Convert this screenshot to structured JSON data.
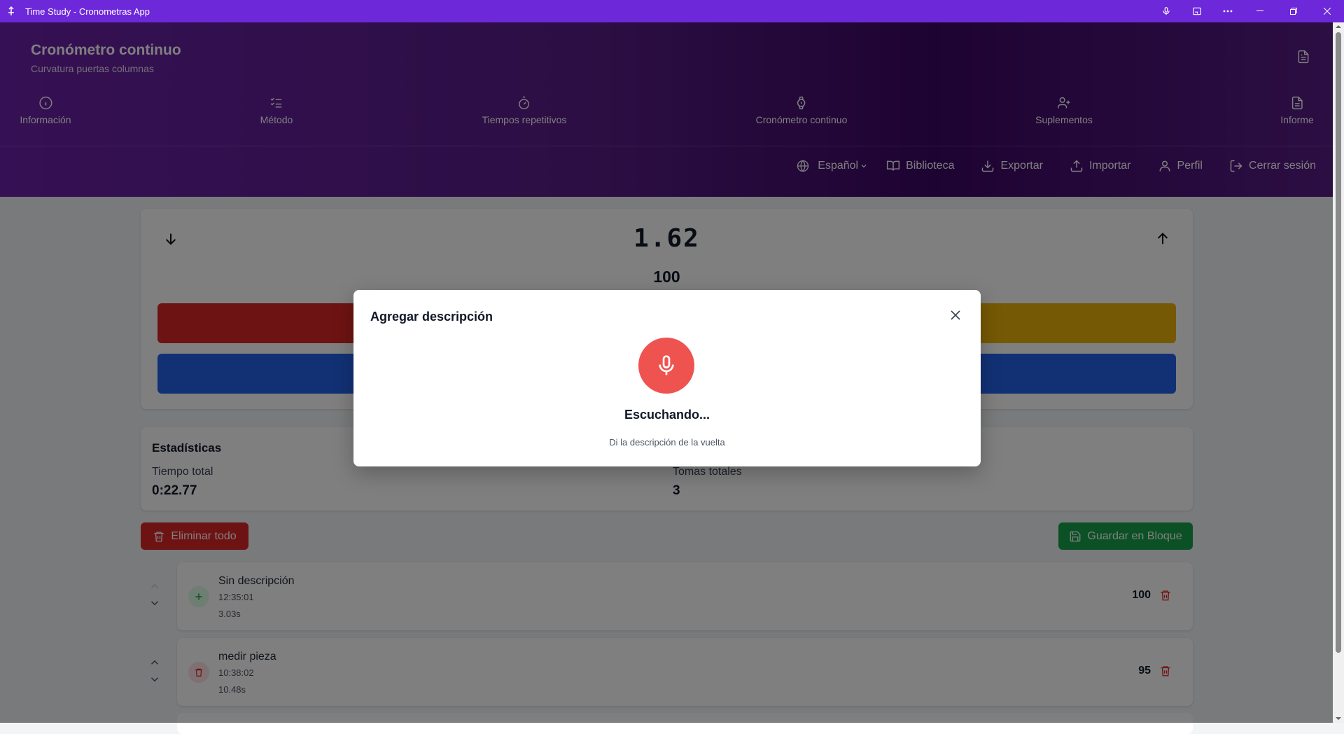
{
  "window": {
    "title": "Time Study - Cronometras App",
    "controls": [
      "microphone",
      "cast",
      "more",
      "minimize",
      "restore",
      "close"
    ]
  },
  "header": {
    "title": "Cronómetro continuo",
    "subtitle": "Curvatura puertas columnas",
    "tabs": [
      {
        "label": "Información",
        "icon": "info-icon"
      },
      {
        "label": "Método",
        "icon": "list-checks-icon"
      },
      {
        "label": "Tiempos repetitivos",
        "icon": "timer-icon"
      },
      {
        "label": "Cronómetro continuo",
        "icon": "watch-icon"
      },
      {
        "label": "Suplementos",
        "icon": "user-plus-icon"
      },
      {
        "label": "Informe",
        "icon": "file-icon"
      }
    ],
    "toolbar": {
      "language": "Español",
      "library": "Biblioteca",
      "export": "Exportar",
      "import": "Importar",
      "profile": "Perfil",
      "logout": "Cerrar sesión"
    }
  },
  "timer": {
    "value": "1.62",
    "rating": "100"
  },
  "stats": {
    "title": "Estadísticas",
    "total_time_label": "Tiempo total",
    "total_time_value": "0:22.77",
    "total_takes_label": "Tomas totales",
    "total_takes_value": "3"
  },
  "actions": {
    "delete_all": "Eliminar todo",
    "save_block": "Guardar en Bloque"
  },
  "laps": [
    {
      "description": "Sin descripción",
      "time": "12:35:01",
      "duration": "3.03s",
      "rating": "100"
    },
    {
      "description": "medir pieza",
      "time": "10:38:02",
      "duration": "10.48s",
      "rating": "95"
    }
  ],
  "modal": {
    "title": "Agregar descripción",
    "status": "Escuchando...",
    "hint": "Di la descripción de la vuelta"
  },
  "colors": {
    "titlebar": "#6d28d9",
    "header": "#581c87",
    "red": "#dc2626",
    "yellow": "#eab308",
    "blue": "#2563eb",
    "green": "#16a34a",
    "mic": "#ef5350"
  }
}
